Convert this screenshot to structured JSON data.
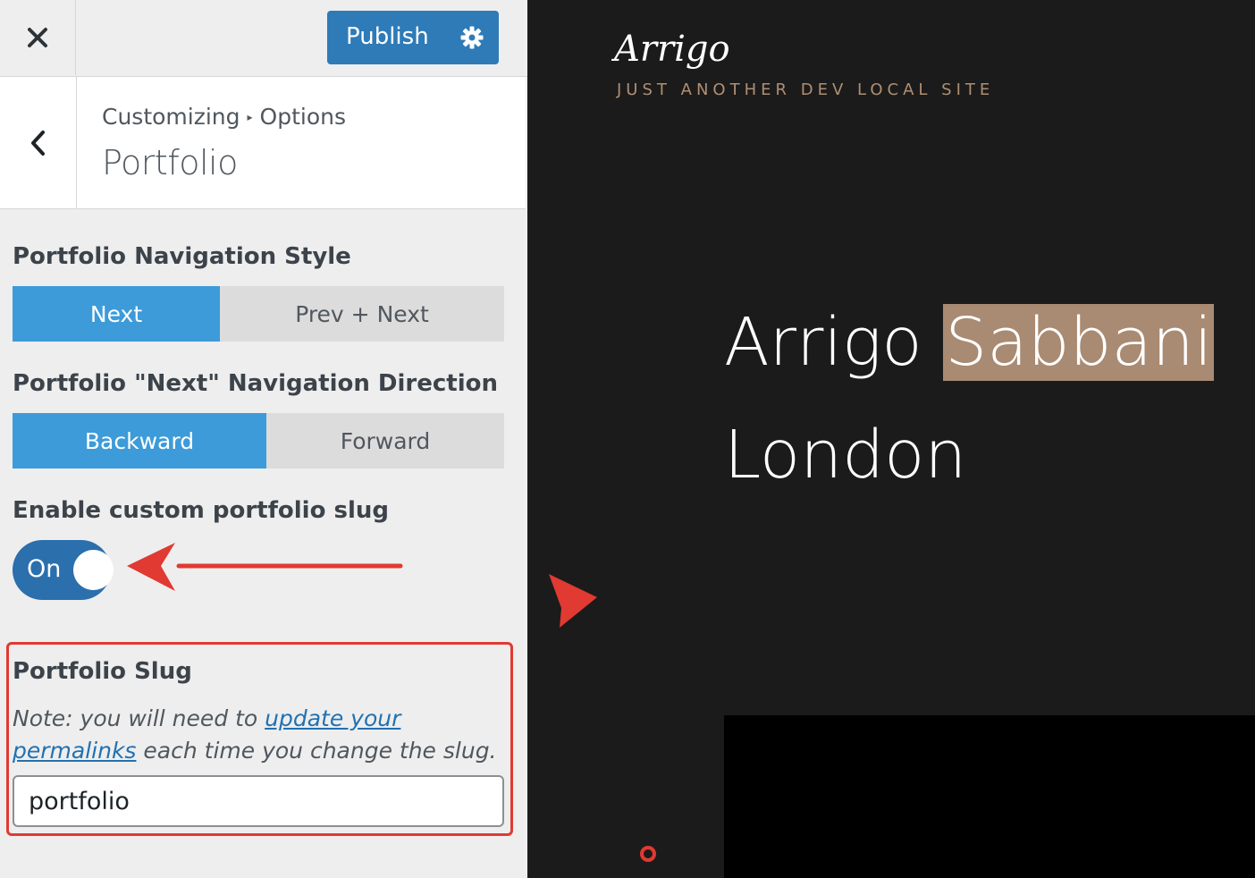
{
  "topbar": {
    "close_icon": "close-icon",
    "publish_label": "Publish",
    "publish_icon": "gear-icon",
    "publish_color": "#2e7bb8"
  },
  "header": {
    "back_icon": "chevron-left-icon",
    "breadcrumb_root": "Customizing",
    "breadcrumb_parent": "Options",
    "title": "Portfolio"
  },
  "controls": {
    "nav_style": {
      "label": "Portfolio Navigation Style",
      "options": [
        "Next",
        "Prev + Next"
      ],
      "selected": "Next"
    },
    "nav_direction": {
      "label": "Portfolio \"Next\" Navigation Direction",
      "options": [
        "Backward",
        "Forward"
      ],
      "selected": "Backward"
    },
    "custom_slug": {
      "label": "Enable custom portfolio slug",
      "toggle_text": "On",
      "checked": true
    },
    "slug": {
      "label": "Portfolio Slug",
      "note_prefix": "Note: you will need to ",
      "note_link": "update your permalinks",
      "note_suffix": " each time you change the slug.",
      "value": "portfolio"
    }
  },
  "preview": {
    "site_title": "Arrigo",
    "tagline": "JUST ANOTHER DEV LOCAL SITE",
    "hero_word1": "Arrigo",
    "hero_word2": "Sabbani",
    "hero_line2": "London",
    "accent_color": "#a98a72"
  },
  "annotation_color": "#e03a32"
}
